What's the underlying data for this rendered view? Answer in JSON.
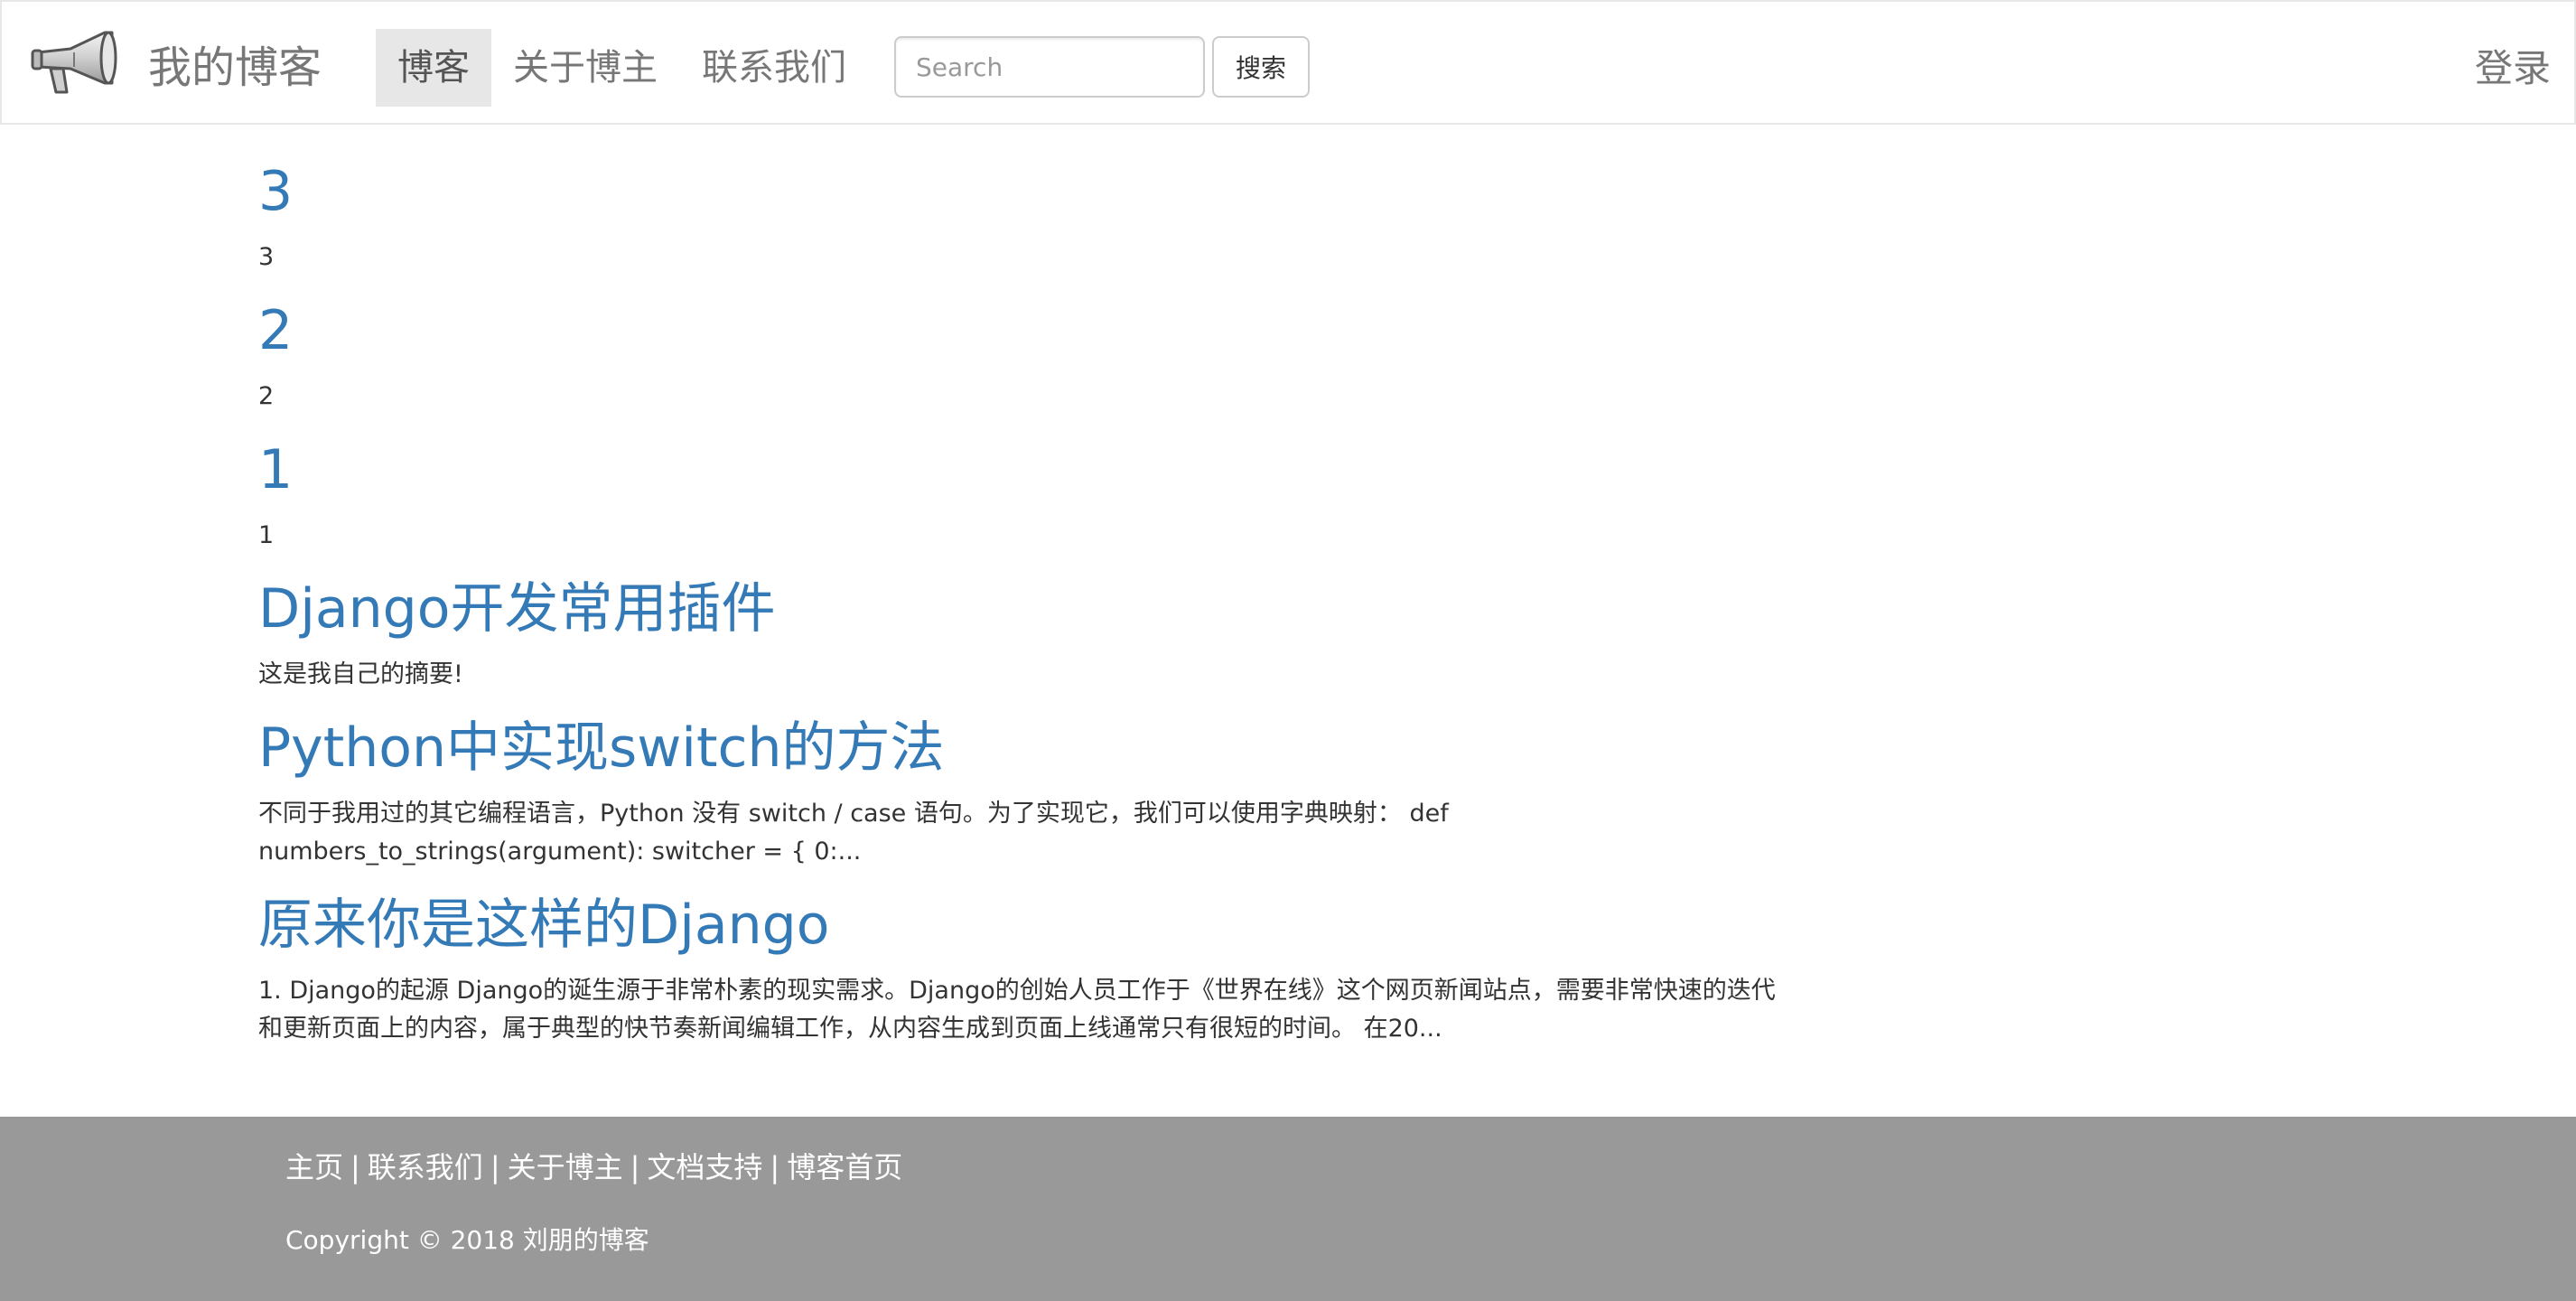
{
  "navbar": {
    "brand_name": "我的博客",
    "items": [
      {
        "label": "博客",
        "active": true
      },
      {
        "label": "关于博主",
        "active": false
      },
      {
        "label": "联系我们",
        "active": false
      }
    ],
    "search_placeholder": "Search",
    "search_button": "搜索",
    "login": "登录",
    "logo_icon": "megaphone-icon"
  },
  "posts": [
    {
      "title": "3",
      "summary": "3"
    },
    {
      "title": "2",
      "summary": "2"
    },
    {
      "title": "1",
      "summary": "1"
    },
    {
      "title": "Django开发常用插件",
      "summary": "这是我自己的摘要!"
    },
    {
      "title": "Python中实现switch的方法",
      "summary": "不同于我用过的其它编程语言，Python 没有 switch / case 语句。为了实现它，我们可以使用字典映射： def numbers_to_strings(argument): switcher = { 0:..."
    },
    {
      "title": "原来你是这样的Django",
      "summary": "1. Django的起源 Django的诞生源于非常朴素的现实需求。Django的创始人员工作于《世界在线》这个网页新闻站点，需要非常快速的迭代和更新页面上的内容，属于典型的快节奏新闻编辑工作，从内容生成到页面上线通常只有很短的时间。 在20..."
    }
  ],
  "footer": {
    "links": [
      "主页",
      "联系我们",
      "关于博主",
      "文档支持",
      "博客首页"
    ],
    "separator": "|",
    "copyright": "Copyright © 2018 刘朋的博客"
  },
  "colors": {
    "link": "#337ab7",
    "nav_text": "#777777",
    "nav_active_bg": "#e7e7e7",
    "footer_bg": "#999999"
  }
}
